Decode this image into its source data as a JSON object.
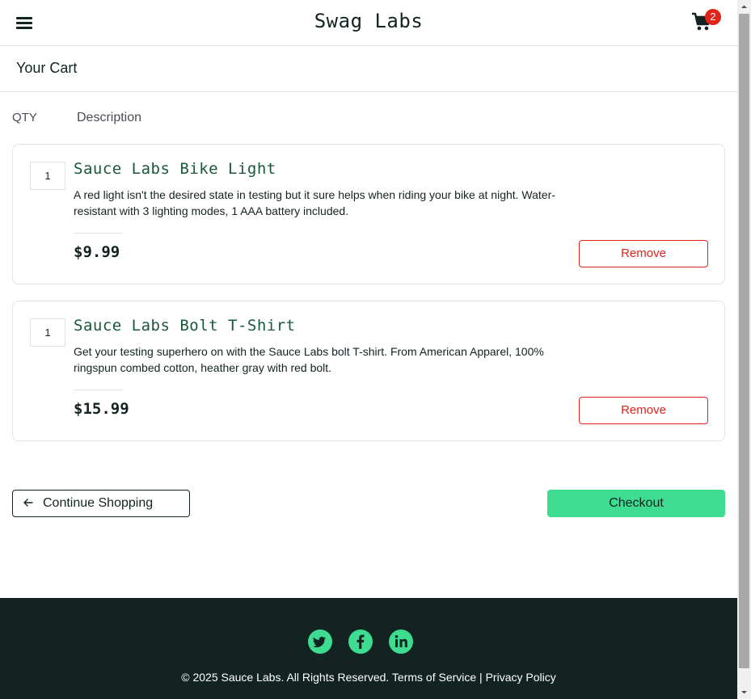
{
  "header": {
    "title": "Swag Labs",
    "cart_count": "2",
    "menu_icon": "hamburger-menu-icon",
    "cart_icon": "shopping-cart-icon"
  },
  "subheader": {
    "title": "Your Cart"
  },
  "columns": {
    "qty": "QTY",
    "description": "Description"
  },
  "items": [
    {
      "qty": "1",
      "name": "Sauce Labs Bike Light",
      "description": "A red light isn't the desired state in testing but it sure helps when riding your bike at night. Water-resistant with 3 lighting modes, 1 AAA battery included.",
      "price": "$9.99",
      "remove_label": "Remove"
    },
    {
      "qty": "1",
      "name": "Sauce Labs Bolt T-Shirt",
      "description": "Get your testing superhero on with the Sauce Labs bolt T-shirt. From American Apparel, 100% ringspun combed cotton, heather gray with red bolt.",
      "price": "$15.99",
      "remove_label": "Remove"
    }
  ],
  "actions": {
    "continue_label": "Continue Shopping",
    "checkout_label": "Checkout"
  },
  "footer": {
    "social": [
      "twitter-icon",
      "facebook-icon",
      "linkedin-icon"
    ],
    "copyright": "© 2025 Sauce Labs. All Rights Reserved. Terms of Service | Privacy Policy"
  },
  "colors": {
    "accent": "#3ddc91",
    "dark": "#132322",
    "danger": "#e2231a",
    "item_title": "#18583a"
  }
}
